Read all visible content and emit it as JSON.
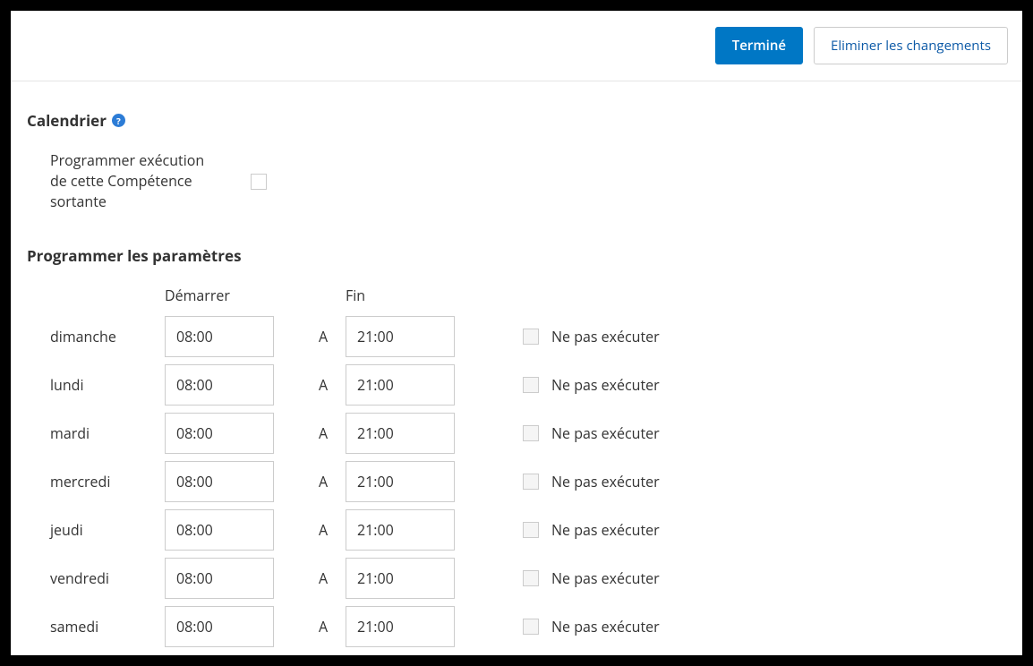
{
  "header": {
    "done_label": "Terminé",
    "discard_label": "Eliminer les changements"
  },
  "calendar": {
    "title": "Calendrier",
    "help": "?",
    "enable_label": "Programmer exécution de cette Compétence sortante"
  },
  "schedule": {
    "title": "Programmer les paramètres",
    "start_header": "Démarrer",
    "end_header": "Fin",
    "separator": "A",
    "nope_label": "Ne pas exécuter",
    "rows": [
      {
        "day": "dimanche",
        "start": "08:00",
        "end": "21:00"
      },
      {
        "day": "lundi",
        "start": "08:00",
        "end": "21:00"
      },
      {
        "day": "mardi",
        "start": "08:00",
        "end": "21:00"
      },
      {
        "day": "mercredi",
        "start": "08:00",
        "end": "21:00"
      },
      {
        "day": "jeudi",
        "start": "08:00",
        "end": "21:00"
      },
      {
        "day": "vendredi",
        "start": "08:00",
        "end": "21:00"
      },
      {
        "day": "samedi",
        "start": "08:00",
        "end": "21:00"
      }
    ]
  }
}
